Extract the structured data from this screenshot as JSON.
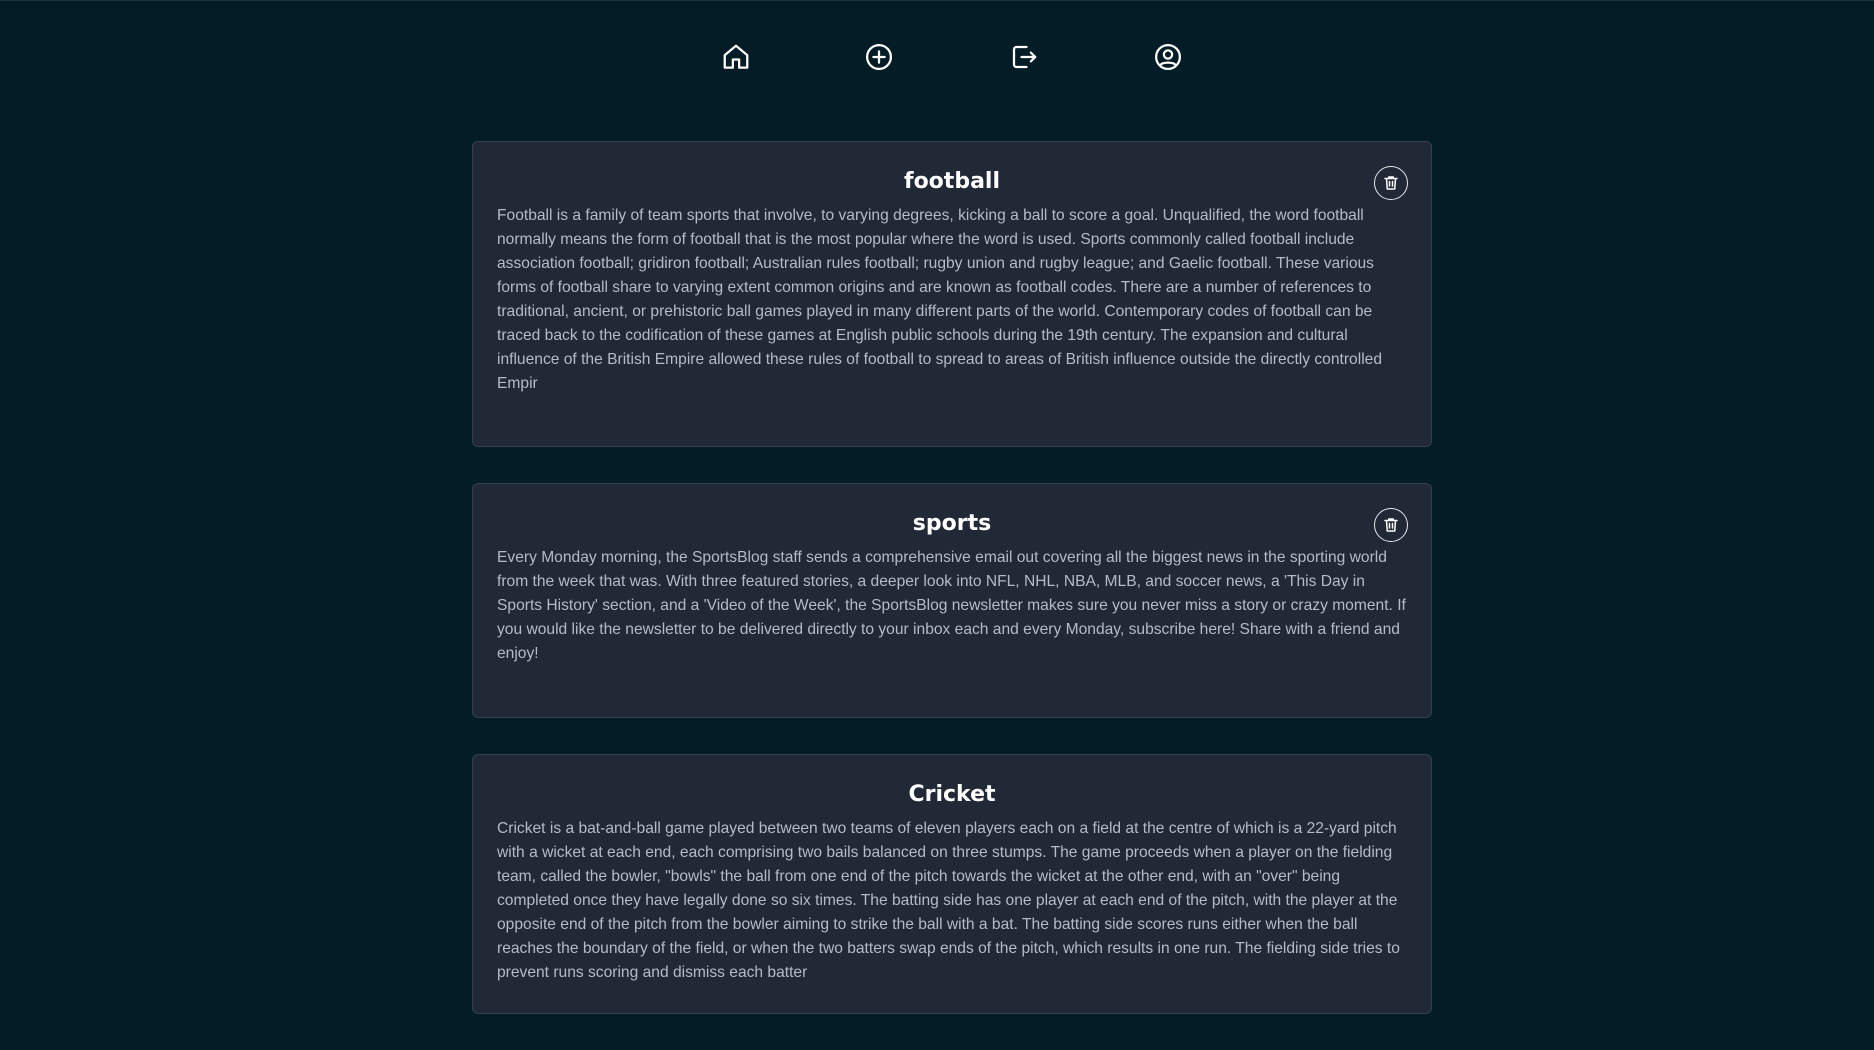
{
  "nav": {
    "items": [
      {
        "icon": "home-icon",
        "name": "home"
      },
      {
        "icon": "plus-circle-icon",
        "name": "create-post"
      },
      {
        "icon": "logout-icon",
        "name": "logout"
      },
      {
        "icon": "user-circle-icon",
        "name": "profile"
      }
    ]
  },
  "posts": [
    {
      "title": "football",
      "body": "Football is a family of team sports that involve, to varying degrees, kicking a ball to score a goal. Unqualified, the word football normally means the form of football that is the most popular where the word is used. Sports commonly called football include association football; gridiron football; Australian rules football; rugby union and rugby league; and Gaelic football. These various forms of football share to varying extent common origins and are known as football codes. There are a number of references to traditional, ancient, or prehistoric ball games played in many different parts of the world. Contemporary codes of football can be traced back to the codification of these games at English public schools during the 19th century. The expansion and cultural influence of the British Empire allowed these rules of football to spread to areas of British influence outside the directly controlled Empir",
      "deletable": true
    },
    {
      "title": "sports",
      "body": "Every Monday morning, the SportsBlog staff sends a comprehensive email out covering all the biggest news in the sporting world from the week that was. With three featured stories, a deeper look into NFL, NHL, NBA, MLB, and soccer news, a 'This Day in Sports History' section, and a 'Video of the Week', the SportsBlog newsletter makes sure you never miss a story or crazy moment. If you would like the newsletter to be delivered directly to your inbox each and every Monday, subscribe here! Share with a friend and enjoy!",
      "deletable": true
    },
    {
      "title": "Cricket",
      "body": "Cricket is a bat-and-ball game played between two teams of eleven players each on a field at the centre of which is a 22-yard pitch with a wicket at each end, each comprising two bails balanced on three stumps. The game proceeds when a player on the fielding team, called the bowler, \"bowls\" the ball from one end of the pitch towards the wicket at the other end, with an \"over\" being completed once they have legally done so six times. The batting side has one player at each end of the pitch, with the player at the opposite end of the pitch from the bowler aiming to strike the ball with a bat. The batting side scores runs either when the ball reaches the boundary of the field, or when the two batters swap ends of the pitch, which results in one run. The fielding side tries to prevent runs scoring and dismiss each batter",
      "deletable": false
    }
  ],
  "colors": {
    "background": "#041c25",
    "card": "#212836",
    "card_border": "#344050",
    "title": "#ffffff",
    "body_text": "#b6bcc6",
    "icon": "#ffffff"
  }
}
